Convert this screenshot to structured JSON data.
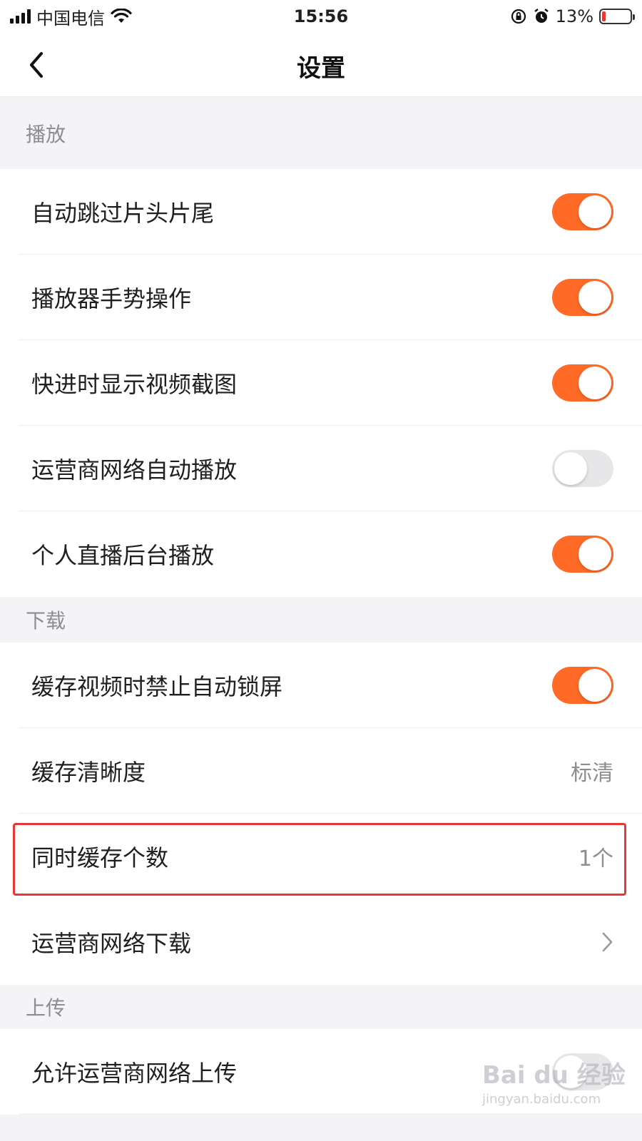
{
  "status_bar": {
    "carrier": "中国电信",
    "time": "15:56",
    "battery_percent": "13%",
    "battery_level": 0.13,
    "icons": [
      "signal-icon",
      "wifi-icon",
      "rotation-lock-icon",
      "alarm-icon",
      "battery-icon"
    ]
  },
  "nav": {
    "title": "设置",
    "back_icon": "chevron-left-icon"
  },
  "sections": {
    "playback": {
      "title": "播放",
      "items": [
        {
          "label": "自动跳过片头片尾",
          "type": "toggle",
          "on": true
        },
        {
          "label": "播放器手势操作",
          "type": "toggle",
          "on": true
        },
        {
          "label": "快进时显示视频截图",
          "type": "toggle",
          "on": true
        },
        {
          "label": "运营商网络自动播放",
          "type": "toggle",
          "on": false
        },
        {
          "label": "个人直播后台播放",
          "type": "toggle",
          "on": true
        }
      ]
    },
    "download": {
      "title": "下载",
      "items": [
        {
          "label": "缓存视频时禁止自动锁屏",
          "type": "toggle",
          "on": true
        },
        {
          "label": "缓存清晰度",
          "type": "value",
          "value": "标清"
        },
        {
          "label": "同时缓存个数",
          "type": "value",
          "value": "1个",
          "highlighted": true
        },
        {
          "label": "运营商网络下载",
          "type": "link",
          "icon": "chevron-right-icon"
        }
      ]
    },
    "upload": {
      "title": "上传",
      "items": [
        {
          "label": "允许运营商网络上传",
          "type": "toggle",
          "on": false
        }
      ]
    }
  },
  "colors": {
    "accent": "#ff6a26",
    "toggle_off": "#e7e7ea",
    "highlight_border": "#e53935"
  },
  "watermark": {
    "logo": "Bai du 经验",
    "url": "jingyan.baidu.com"
  }
}
